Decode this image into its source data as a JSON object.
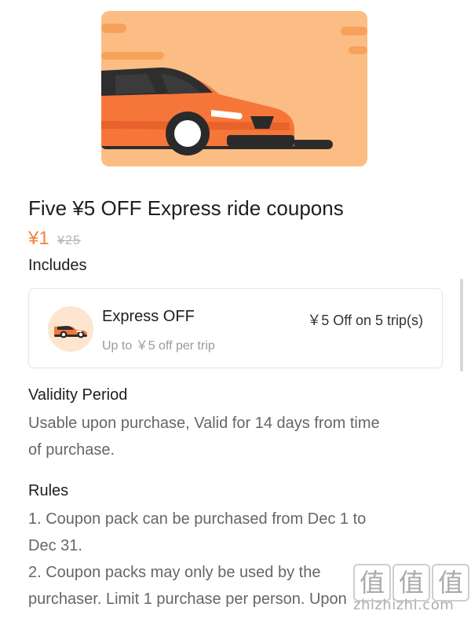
{
  "product": {
    "hero_image_alt": "orange car illustration",
    "title": "Five ¥5 OFF Express ride coupons",
    "price": "¥1",
    "original_price": "¥25"
  },
  "includes": {
    "heading": "Includes",
    "coupon": {
      "icon": "car-icon",
      "name": "Express OFF",
      "description": "Up to ￥5 off per trip",
      "value": "￥5 Off on 5 trip(s)"
    }
  },
  "validity": {
    "heading": "Validity Period",
    "lines": [
      "Usable upon purchase, Valid for 14 days from time",
      "of purchase."
    ]
  },
  "rules": {
    "heading": "Rules",
    "lines": [
      "1. Coupon pack can be purchased from Dec 1 to",
      "Dec 31.",
      "2. Coupon packs may only be used by the",
      "purchaser. Limit 1 purchase per person. Upon"
    ]
  },
  "watermark": {
    "glyphs": [
      "值",
      "值",
      "值"
    ],
    "text": "zhizhizhi.com"
  },
  "colors": {
    "accent": "#f5823a",
    "hero_bg": "#fbbd83"
  }
}
